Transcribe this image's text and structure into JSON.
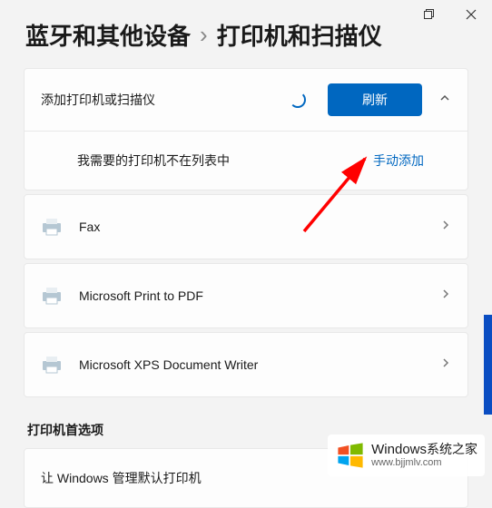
{
  "breadcrumb": {
    "parent": "蓝牙和其他设备",
    "separator": "›",
    "current": "打印机和扫描仪"
  },
  "add_printer": {
    "label": "添加打印机或扫描仪",
    "refresh_button": "刷新",
    "not_listed_label": "我需要的打印机不在列表中",
    "manual_add_link": "手动添加"
  },
  "printers": [
    {
      "name": "Fax"
    },
    {
      "name": "Microsoft Print to PDF"
    },
    {
      "name": "Microsoft XPS Document Writer"
    }
  ],
  "prefs": {
    "heading": "打印机首选项",
    "manage_default_label": "让 Windows 管理默认打印机"
  },
  "watermark": {
    "brand_en": "Windows",
    "brand_cn": "系统之家",
    "url": "www.bjjmlv.com"
  }
}
